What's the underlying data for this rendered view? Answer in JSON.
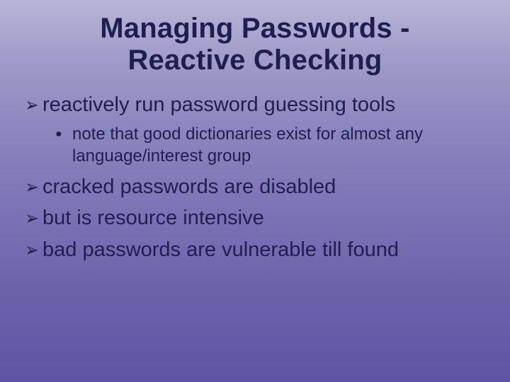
{
  "title_line1": "Managing Passwords -",
  "title_line2": "Reactive Checking",
  "bullets": {
    "b1": "reactively run password guessing tools",
    "b1_sub1": "note that good dictionaries exist for almost any language/interest group",
    "b2": "cracked passwords are disabled",
    "b3": "but is resource intensive",
    "b4": "bad passwords are vulnerable till found"
  },
  "glyphs": {
    "arrow": "➢",
    "dot": "●"
  }
}
